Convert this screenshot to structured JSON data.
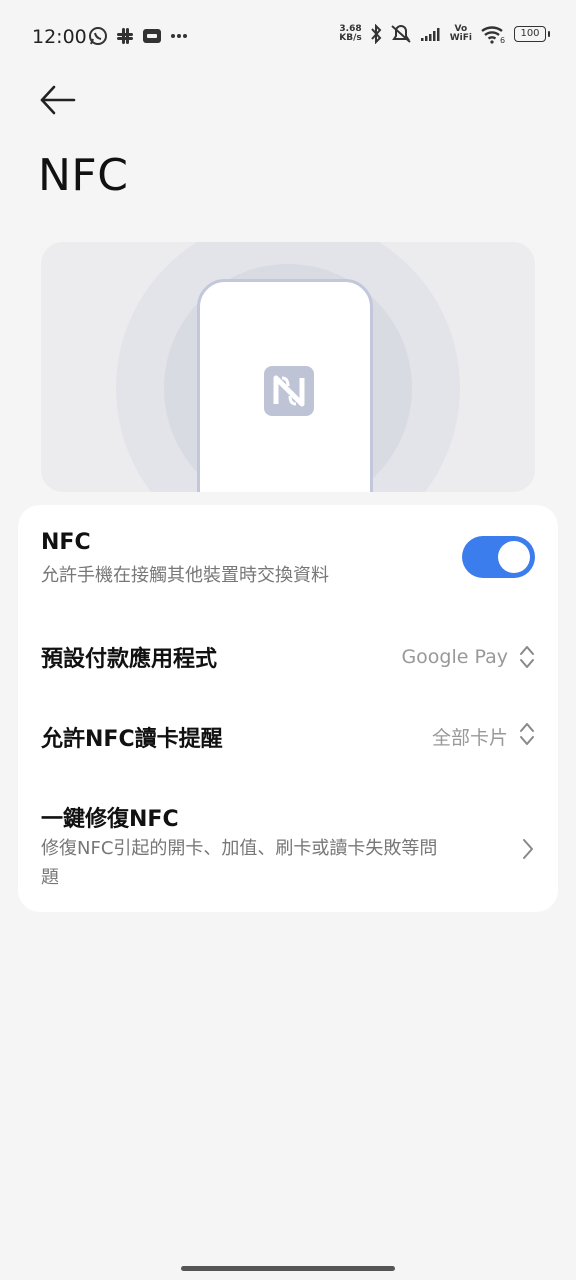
{
  "status_bar": {
    "time": "12:00",
    "net_speed_value": "3.68",
    "net_speed_unit": "KB/s",
    "vowifi_top": "Vo",
    "vowifi_bottom": "WiFi",
    "wifi_badge": "6",
    "battery": "100",
    "left_icons": [
      "whatsapp-icon",
      "slack-icon",
      "game-icon",
      "more-icon"
    ],
    "right_icons": [
      "bluetooth-icon",
      "mute-icon",
      "signal-icon",
      "vowifi-icon",
      "wifi-icon",
      "battery-icon"
    ]
  },
  "header": {
    "back_icon": "arrow-left-icon",
    "title": "NFC"
  },
  "illustration": {
    "logo_icon": "nfc-n-mark-icon",
    "colors": {
      "panel": "#ececef",
      "wave_outer": "#e3e4ea",
      "wave_inner": "#d9dbe3",
      "phone_border": "#c3c7dc",
      "logo": "#bfc3d6"
    }
  },
  "settings": {
    "nfc_toggle": {
      "title": "NFC",
      "subtitle": "允許手機在接觸其他裝置時交換資料",
      "state": "on",
      "color": "#3b7ded"
    },
    "default_payment": {
      "title": "預設付款應用程式",
      "value": "Google Pay",
      "icon": "up-down-chevron-icon"
    },
    "card_reader_alert": {
      "title": "允許NFC讀卡提醒",
      "value": "全部卡片",
      "icon": "up-down-chevron-icon"
    },
    "one_click_repair": {
      "title": "一鍵修復NFC",
      "subtitle_line1": "修復NFC引起的開卡、加值、刷卡或讀卡失敗等問",
      "subtitle_line2": "題",
      "icon": "chevron-right-icon"
    }
  }
}
